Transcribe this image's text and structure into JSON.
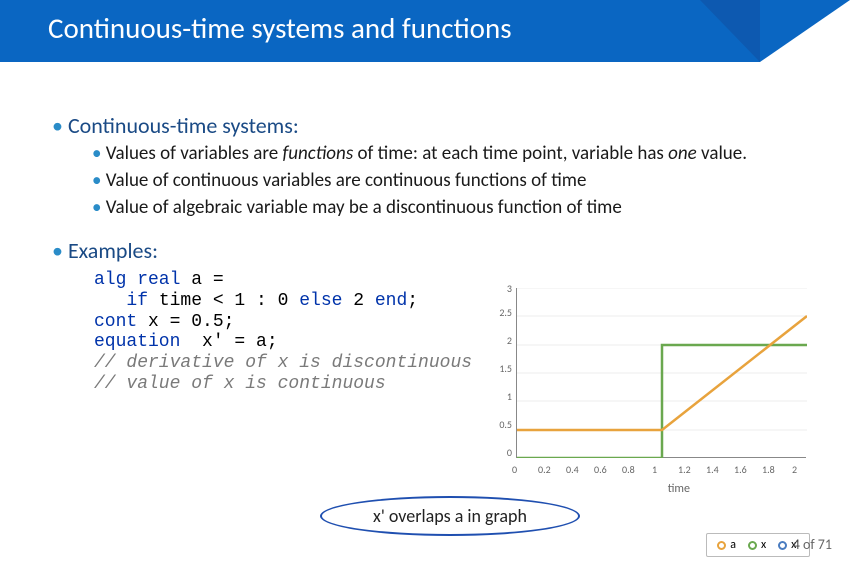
{
  "header": {
    "title": "Continuous-time systems and functions"
  },
  "section1": {
    "heading": "Continuous-time systems:",
    "b1_a": "Values of variables are ",
    "b1_em": "functions",
    "b1_b": " of time: at each time point, variable has ",
    "b1_em2": "one",
    "b1_c": " value.",
    "b2": "Value of continuous variables are continuous functions of time",
    "b3": "Value of algebraic variable may be a discontinuous function of time"
  },
  "section2": {
    "heading": "Examples:"
  },
  "code": {
    "l1a": "alg",
    "l1b": " real",
    "l1c": " a =",
    "l2a": "   if",
    "l2b": " time < 1 : 0 ",
    "l2c": "else",
    "l2d": " 2 ",
    "l2e": "end",
    "l2f": ";",
    "l3a": "cont",
    "l3b": " x = 0.5;",
    "l4a": "equation",
    "l4b": "  x' = a;",
    "l5": "// derivative of x is discontinuous",
    "l6": "// value of x is continuous"
  },
  "callout": "x' overlaps a in graph",
  "chart_data": {
    "type": "line",
    "xlabel": "time",
    "xlim": [
      0,
      2
    ],
    "ylim": [
      0,
      3.0
    ],
    "xticks": [
      0,
      0.2,
      0.4,
      0.6,
      0.8,
      1,
      1.2,
      1.4,
      1.6,
      1.8,
      2
    ],
    "yticks": [
      0.0,
      0.5,
      1.0,
      1.5,
      2.0,
      2.5,
      3.0
    ],
    "series": [
      {
        "name": "a",
        "color": "#6aa84f",
        "x": [
          0,
          1,
          1,
          2
        ],
        "y": [
          0,
          0,
          2,
          2
        ]
      },
      {
        "name": "x",
        "color": "#e8a33d",
        "x": [
          0,
          1,
          2
        ],
        "y": [
          0.5,
          0.5,
          2.5
        ]
      },
      {
        "name": "x'",
        "color": "#6aa84f",
        "x": [
          0,
          1,
          1,
          2
        ],
        "y": [
          0,
          0,
          2,
          2
        ]
      }
    ]
  },
  "legend": {
    "a": "a",
    "x": "x",
    "xp": "x'"
  },
  "page": {
    "current": "4",
    "sep": " of ",
    "total": "71"
  }
}
